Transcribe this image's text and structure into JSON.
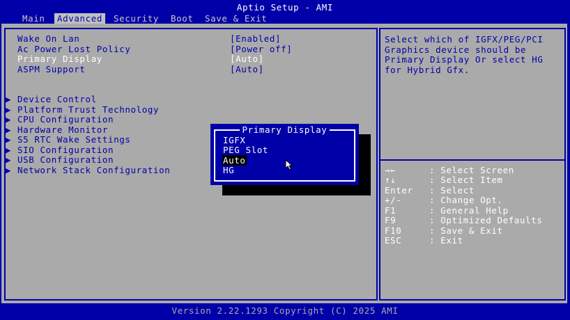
{
  "header": {
    "title": "Aptio Setup - AMI"
  },
  "tabs": [
    {
      "label": "Main"
    },
    {
      "label": "Advanced"
    },
    {
      "label": "Security"
    },
    {
      "label": "Boot"
    },
    {
      "label": "Save & Exit"
    }
  ],
  "active_tab": "Advanced",
  "settings": [
    {
      "label": "Wake On Lan",
      "value": "[Enabled]"
    },
    {
      "label": "Ac Power Lost Policy",
      "value": "[Power off]"
    },
    {
      "label": "Primary Display",
      "value": "[Auto]"
    },
    {
      "label": "ASPM Support",
      "value": "[Auto]"
    }
  ],
  "submenus": [
    {
      "label": "Device Control"
    },
    {
      "label": "Platform Trust Technology"
    },
    {
      "label": "CPU Configuration"
    },
    {
      "label": "Hardware Monitor"
    },
    {
      "label": "S5 RTC Wake Settings"
    },
    {
      "label": "SIO Configuration"
    },
    {
      "label": "USB Configuration"
    },
    {
      "label": "Network Stack Configuration"
    }
  ],
  "submenu_arrow": "▶",
  "help": {
    "lines": [
      "Select which of IGFX/PEG/PCI",
      "Graphics device should be",
      "Primary Display Or select HG",
      "for Hybrid Gfx."
    ]
  },
  "keys": [
    {
      "key": "→←",
      "desc": ": Select Screen"
    },
    {
      "key": "↑↓",
      "desc": ": Select Item"
    },
    {
      "key": "Enter",
      "desc": ": Select"
    },
    {
      "key": "+/-",
      "desc": ": Change Opt."
    },
    {
      "key": "F1",
      "desc": ": General Help"
    },
    {
      "key": "F9",
      "desc": ": Optimized Defaults"
    },
    {
      "key": "F10",
      "desc": ": Save & Exit"
    },
    {
      "key": "ESC",
      "desc": ": Exit"
    }
  ],
  "popup": {
    "title": "Primary Display",
    "options": [
      "IGFX",
      "PEG Slot",
      "Auto",
      "HG"
    ],
    "selected": "Auto"
  },
  "footer": {
    "text": "Version 2.22.1293 Copyright (C) 2025 AMI"
  },
  "colors": {
    "background": "#0000a8",
    "panel": "#aaaaaa",
    "highlight_text": "#ffffff",
    "popup_shadow": "#000000"
  }
}
